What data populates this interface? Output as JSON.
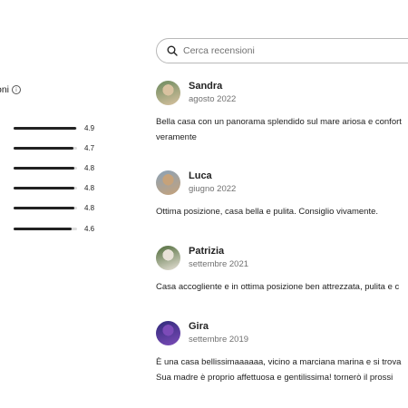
{
  "ratings_panel": {
    "header_partial": "oni",
    "rows": [
      {
        "value": "4.9",
        "fraction": 0.98
      },
      {
        "value": "4.7",
        "fraction": 0.94
      },
      {
        "value": "4.8",
        "fraction": 0.96
      },
      {
        "value": "4.8",
        "fraction": 0.96
      },
      {
        "value": "4.8",
        "fraction": 0.96
      },
      {
        "value": "4.6",
        "fraction": 0.92
      }
    ]
  },
  "search": {
    "placeholder": "Cerca recensioni",
    "icon": "search-icon"
  },
  "reviews": [
    {
      "name": "Sandra",
      "date": "agosto 2022",
      "text_line1": "Bella casa con un panorama splendido sul mare ariosa e confort",
      "text_line2": "veramente",
      "avatar_colors": [
        "#6b8a5e",
        "#d9c2a0"
      ]
    },
    {
      "name": "Luca",
      "date": "giugno 2022",
      "text_line1": "Ottima posizione, casa bella e pulita. Consiglio vivamente.",
      "text_line2": "",
      "avatar_colors": [
        "#8aa2b8",
        "#c6a27a"
      ]
    },
    {
      "name": "Patrizia",
      "date": "settembre 2021",
      "text_line1": "Casa accogliente e in ottima posizione ben attrezzata, pulita e c",
      "text_line2": "",
      "avatar_colors": [
        "#4f6b3a",
        "#e8e2d8"
      ]
    },
    {
      "name": "Gira",
      "date": "settembre 2019",
      "text_line1": "È una casa bellissimaaaaaa,   vicino a marciana marina e si trova",
      "text_line2": "Sua madre è proprio affettuosa e gentilissima!   tornerò il prossi",
      "avatar_colors": [
        "#2f2a7a",
        "#7c4bb8"
      ]
    }
  ]
}
